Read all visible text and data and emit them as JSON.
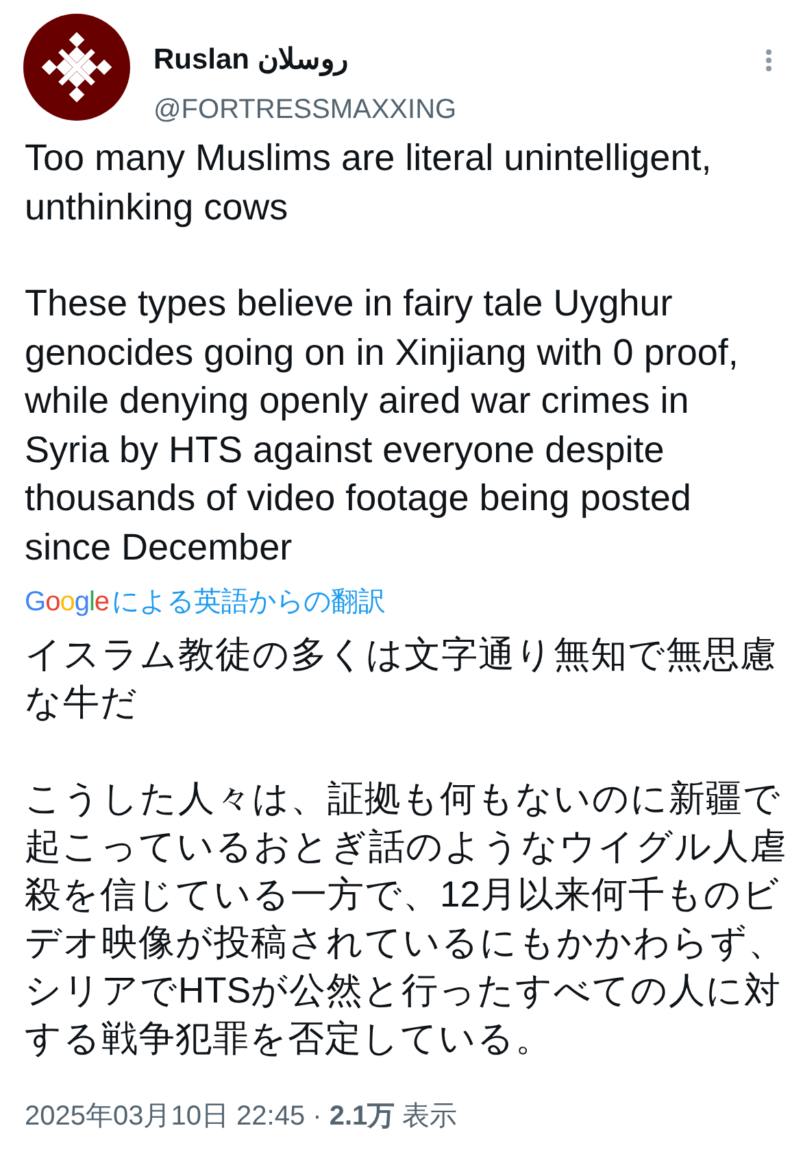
{
  "author": {
    "name": "Ruslan روسلان",
    "handle": "@FORTRESSMAXXING"
  },
  "original_paragraphs": [
    [
      "Too many Muslims are literal unintelligent,",
      "unthinking cows"
    ],
    [
      "These types believe in fairy tale Uyghur",
      "genocides going on in Xinjiang with 0 proof,",
      "while denying openly aired war crimes in",
      "Syria by HTS against everyone despite",
      "thousands of video footage being posted",
      "since December"
    ]
  ],
  "translation": {
    "google_logo": "Google",
    "link": "による英語からの翻訳"
  },
  "translated_paragraphs": [
    [
      "イスラム教徒の多くは文字通り無知で無思慮",
      "な牛だ"
    ],
    [
      "こうした人々は、証拠も何もないのに新疆で",
      "起こっているおとぎ話のようなウイグル人虐",
      "殺を信じている一方で、12月以来何千ものビ",
      "デオ映像が投稿されているにもかかわらず、",
      "シリアでHTSが公然と行ったすべての人に対",
      "する戦争犯罪を否定している。"
    ]
  ],
  "footer": "2025年03月10日 22:45 · **2.1万** 表示"
}
